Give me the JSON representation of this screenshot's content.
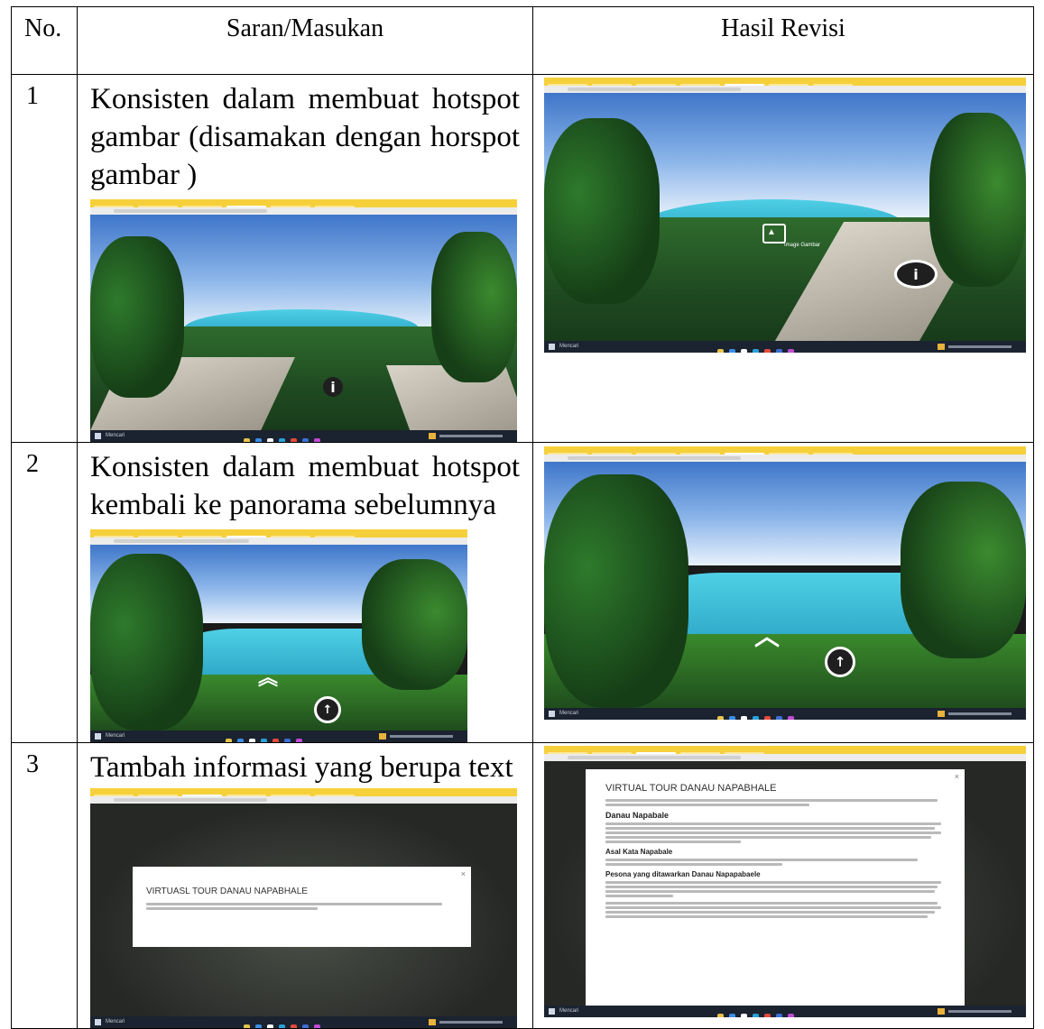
{
  "headers": {
    "no": "No.",
    "saran": "Saran/Masukan",
    "hasil": "Hasil Revisi"
  },
  "rows": [
    {
      "no": "1",
      "suggestion": "Konsisten dalam membuat hotspot gambar (disamakan dengan horspot gambar )"
    },
    {
      "no": "2",
      "suggestion": "Konsisten dalam membuat hotspot kembali ke panorama sebelumnya"
    },
    {
      "no": "3",
      "suggestion": "Tambah informasi yang berupa text"
    }
  ],
  "screens": {
    "taskbar_search": "Mencari",
    "image_hotspot_label": "Image Gambar",
    "modal_before_title": "VIRTUASL TOUR DANAU NAPABHALE",
    "modal_after": {
      "title": "VIRTUAL TOUR DANAU NAPABHALE",
      "section_1": "Danau Napabale",
      "section_2": "Asal Kata Napabale",
      "section_3": "Pesona yang ditawarkan Danau Napapabaele"
    }
  }
}
